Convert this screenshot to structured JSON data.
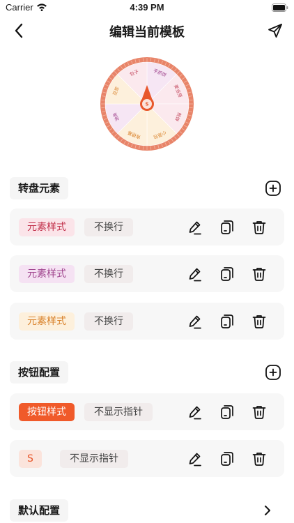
{
  "status": {
    "carrier": "Carrier",
    "time": "4:39 PM"
  },
  "nav": {
    "title": "编辑当前模板"
  },
  "wheel": {
    "center_label": "S",
    "segments": [
      {
        "label": "手抓饼",
        "color": "#f6e6f4",
        "text_color": "#a0458e"
      },
      {
        "label": "麦当劳",
        "color": "#fbe9ee",
        "text_color": "#c2445a"
      },
      {
        "label": "煎饼",
        "color": "#fbe9ee",
        "text_color": "#c2445a"
      },
      {
        "label": "小笼包",
        "color": "#fdf0dc",
        "text_color": "#d9822b"
      },
      {
        "label": "肯德基",
        "color": "#fdf0dc",
        "text_color": "#d9822b"
      },
      {
        "label": "油条",
        "color": "#f6e6f4",
        "text_color": "#a0458e"
      },
      {
        "label": "豆浆",
        "color": "#fdf0dc",
        "text_color": "#d9822b"
      },
      {
        "label": "包子",
        "color": "#fbe9ee",
        "text_color": "#c2445a"
      }
    ],
    "rim_color": "#e88469",
    "pointer_color": "#e8572b"
  },
  "sections": {
    "elements": {
      "title": "转盘元素"
    },
    "buttons": {
      "title": "按钮配置"
    },
    "defaults": {
      "title": "默认配置"
    }
  },
  "element_rows": [
    {
      "style_label": "元素样式",
      "mode_label": "不换行",
      "bg": "#fbe4e9",
      "fg": "#c2314b"
    },
    {
      "style_label": "元素样式",
      "mode_label": "不换行",
      "bg": "#f5e2f3",
      "fg": "#a0458e"
    },
    {
      "style_label": "元素样式",
      "mode_label": "不换行",
      "bg": "#fdf0dc",
      "fg": "#d9822b"
    }
  ],
  "button_rows": [
    {
      "style_label": "按钮样式",
      "mode_label": "不显示指针",
      "bg": "#f05a2a",
      "fg": "#ffffff"
    },
    {
      "style_label": "S",
      "mode_label": "不显示指针",
      "bg": "#fbe4dc",
      "fg": "#e8572b"
    }
  ]
}
